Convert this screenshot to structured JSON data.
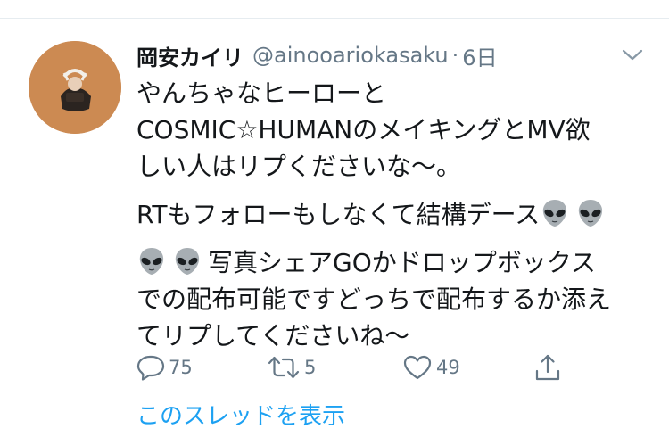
{
  "tweet": {
    "display_name": "岡安カイリ",
    "handle": "@ainooariokasaku",
    "separator": "·",
    "timestamp": "6日",
    "body": {
      "p1_line1": "やんちゃなヒーローと",
      "p1_line2": "COSMIC☆HUMANのメイキングとMV欲",
      "p1_line3": "しい人はリプくださいな〜。",
      "p2_line1_text": "RTもフォローもしなくて結構デース",
      "p3_line1_text": "写真シェアGOかドロップボックス",
      "p3_line2": "での配布可能ですどっちで配布するか添え",
      "p3_line3": "てリプしてくださいね〜"
    },
    "emoji": "alien-emoji",
    "actions": {
      "reply_count": "75",
      "retweet_count": "5",
      "like_count": "49"
    },
    "thread_link": "このスレッドを表示"
  },
  "colors": {
    "text": "#14171a",
    "secondary": "#657786",
    "link": "#1da1f2",
    "avatar_bg": "#cc8a52",
    "divider": "#e6ecf0"
  },
  "icons": [
    "reply-icon",
    "retweet-icon",
    "like-icon",
    "share-icon",
    "caret-down-icon",
    "alien-emoji"
  ]
}
